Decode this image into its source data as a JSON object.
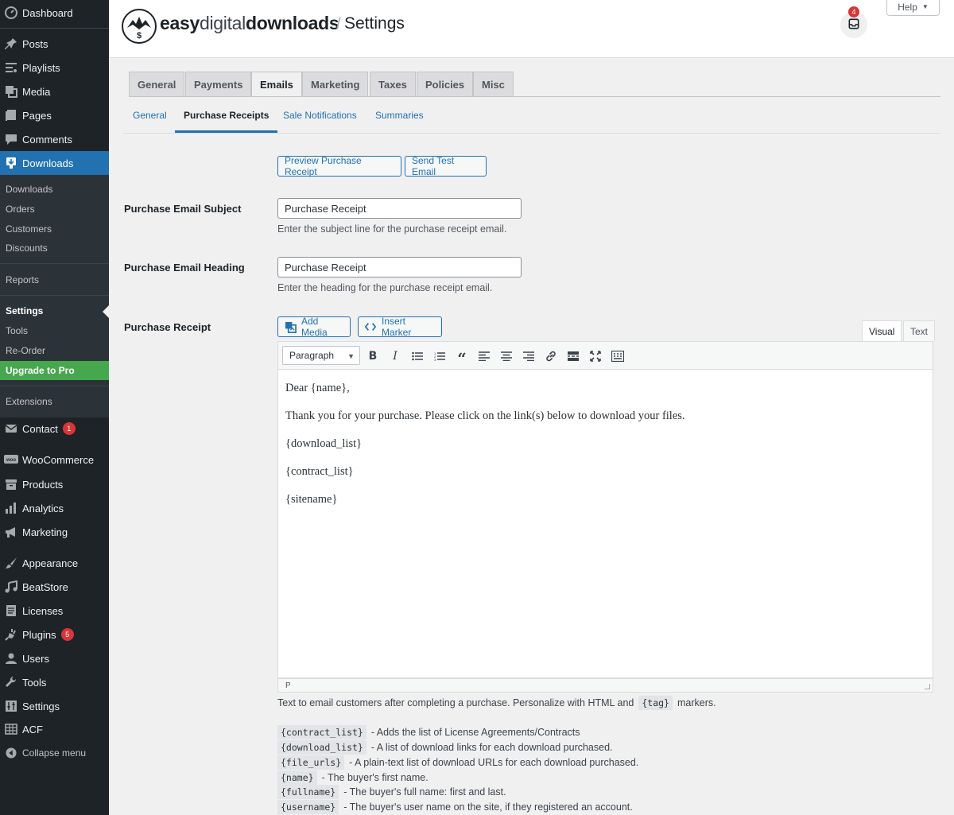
{
  "sidebar": {
    "dashboard": "Dashboard",
    "posts": "Posts",
    "playlists": "Playlists",
    "media": "Media",
    "pages": "Pages",
    "comments": "Comments",
    "downloads": "Downloads",
    "sub_downloads": "Downloads",
    "sub_orders": "Orders",
    "sub_customers": "Customers",
    "sub_discounts": "Discounts",
    "sub_reports": "Reports",
    "sub_settings": "Settings",
    "sub_tools": "Tools",
    "sub_reorder": "Re-Order",
    "sub_upgrade": "Upgrade to Pro",
    "sub_extensions": "Extensions",
    "contact": "Contact",
    "contact_badge": "1",
    "woocommerce": "WooCommerce",
    "products": "Products",
    "analytics": "Analytics",
    "marketing": "Marketing",
    "appearance": "Appearance",
    "beatstore": "BeatStore",
    "licenses": "Licenses",
    "plugins": "Plugins",
    "plugins_badge": "5",
    "users": "Users",
    "tools": "Tools",
    "settings": "Settings",
    "acf": "ACF",
    "collapse": "Collapse menu"
  },
  "header": {
    "brand_bold": "easy",
    "brand_light": "digital",
    "brand_bold2": "downloads",
    "separator": "/",
    "page_title": "Settings",
    "inbox_count": "4",
    "help": "Help"
  },
  "tabs": [
    "General",
    "Payments",
    "Emails",
    "Marketing",
    "Taxes",
    "Policies",
    "Misc"
  ],
  "subtabs": [
    "General",
    "Purchase Receipts",
    "Sale Notifications",
    "Summaries"
  ],
  "form": {
    "preview_button": "Preview Purchase Receipt",
    "test_button": "Send Test Email",
    "subject_label": "Purchase Email Subject",
    "subject_value": "Purchase Receipt",
    "subject_desc": "Enter the subject line for the purchase receipt email.",
    "heading_label": "Purchase Email Heading",
    "heading_value": "Purchase Receipt",
    "heading_desc": "Enter the heading for the purchase receipt email.",
    "receipt_label": "Purchase Receipt",
    "add_media": "Add Media",
    "insert_marker": "Insert Marker",
    "visual_tab": "Visual",
    "text_tab": "Text",
    "paragraph_select": "Paragraph"
  },
  "editor": {
    "lines": [
      "Dear {name},",
      "Thank you for your purchase. Please click on the link(s) below to download your files.",
      "{download_list}",
      "{contract_list}",
      "{sitename}"
    ],
    "status": "P"
  },
  "help": {
    "intro_before": "Text to email customers after completing a purchase. Personalize with HTML and",
    "intro_code": "{tag}",
    "intro_after": "markers.",
    "tags": [
      {
        "code": "{contract_list}",
        "text": "- Adds the list of License Agreements/Contracts"
      },
      {
        "code": "{download_list}",
        "text": "- A list of download links for each download purchased."
      },
      {
        "code": "{file_urls}",
        "text": "- A plain-text list of download URLs for each download purchased."
      },
      {
        "code": "{name}",
        "text": "- The buyer's first name."
      },
      {
        "code": "{fullname}",
        "text": "- The buyer's full name: first and last."
      },
      {
        "code": "{username}",
        "text": "- The buyer's user name on the site, if they registered an account."
      }
    ]
  }
}
